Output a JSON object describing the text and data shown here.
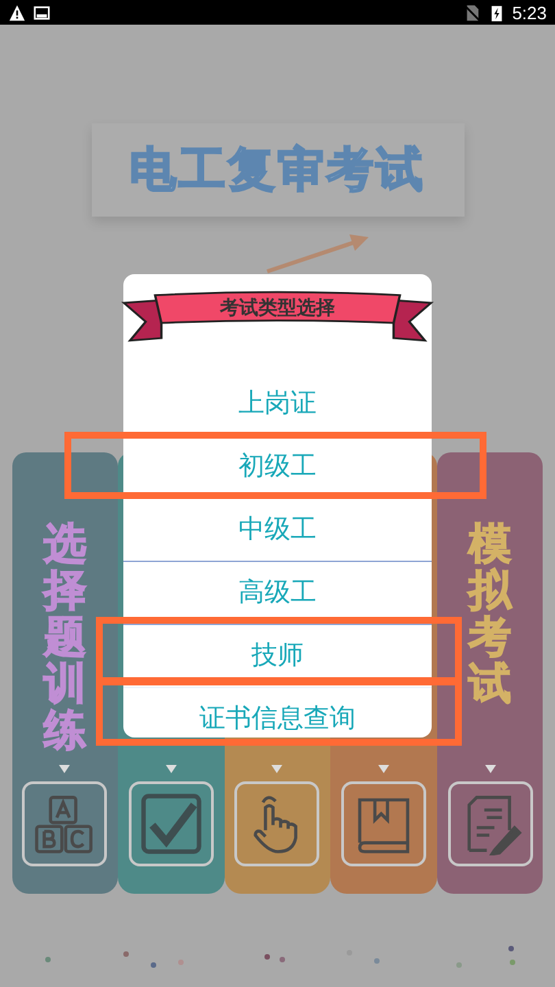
{
  "status_bar": {
    "time": "5:23"
  },
  "app_title": "电工复审考试",
  "modules": [
    {
      "label": "选择题训练",
      "color": "#5e7a82",
      "kind": "abc"
    },
    {
      "color": "#4e8a88",
      "kind": "check"
    },
    {
      "color": "#b48a52",
      "kind": "hand"
    },
    {
      "color": "#b27850",
      "kind": "book"
    },
    {
      "label": "模拟考试",
      "color": "#8c6274",
      "kind": "paper"
    }
  ],
  "dialog": {
    "title": "考试类型选择",
    "options": [
      {
        "label": "上岗证",
        "highlighted": false
      },
      {
        "label": "初级工",
        "highlighted": true
      },
      {
        "label": "中级工",
        "highlighted": false
      },
      {
        "label": "高级工",
        "highlighted": false
      },
      {
        "label": "技师",
        "highlighted": true
      },
      {
        "label": "证书信息查询",
        "highlighted": true
      }
    ]
  }
}
